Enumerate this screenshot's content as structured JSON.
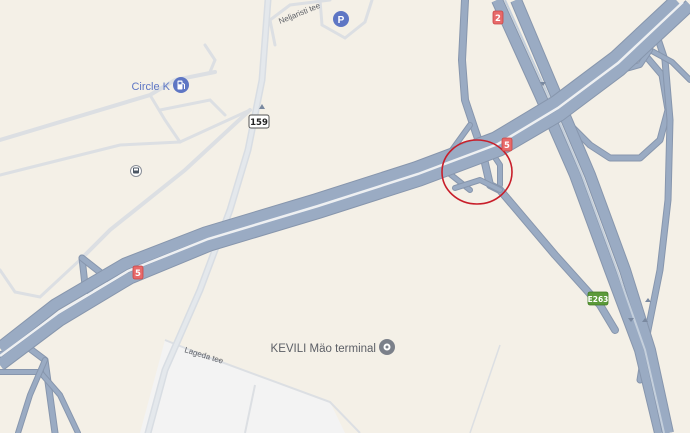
{
  "map": {
    "colors": {
      "land": "#f4f0e7",
      "road_fill": "#9aabc3",
      "road_edge": "#8796ad",
      "road_inner": "#c4cfdc",
      "minor_road": "#dcdfe3",
      "built_area": "#f3f3f3",
      "highlight_circle": "#c81e2a",
      "route_shield_red": "#e76a6a",
      "route_shield_green": "#5c9a3a",
      "poi_blue": "#5e76c4",
      "label_text": "#5c5f66"
    },
    "labels": {
      "circle_k": "Circle K",
      "kevili": "KEVILI Mäo terminal",
      "neljaristi": "Neljaristi tee",
      "lageda": "Lageda tee"
    },
    "shields": {
      "route_159": "159",
      "route_2": "2",
      "route_5_east": "5",
      "route_5_west": "5",
      "route_e263": "E263"
    },
    "icons": {
      "fuel": "fuel-pump-icon",
      "parking": "parking-icon",
      "parking_letter": "P",
      "bus": "bus-stop-icon",
      "pin": "location-pin-icon"
    }
  }
}
